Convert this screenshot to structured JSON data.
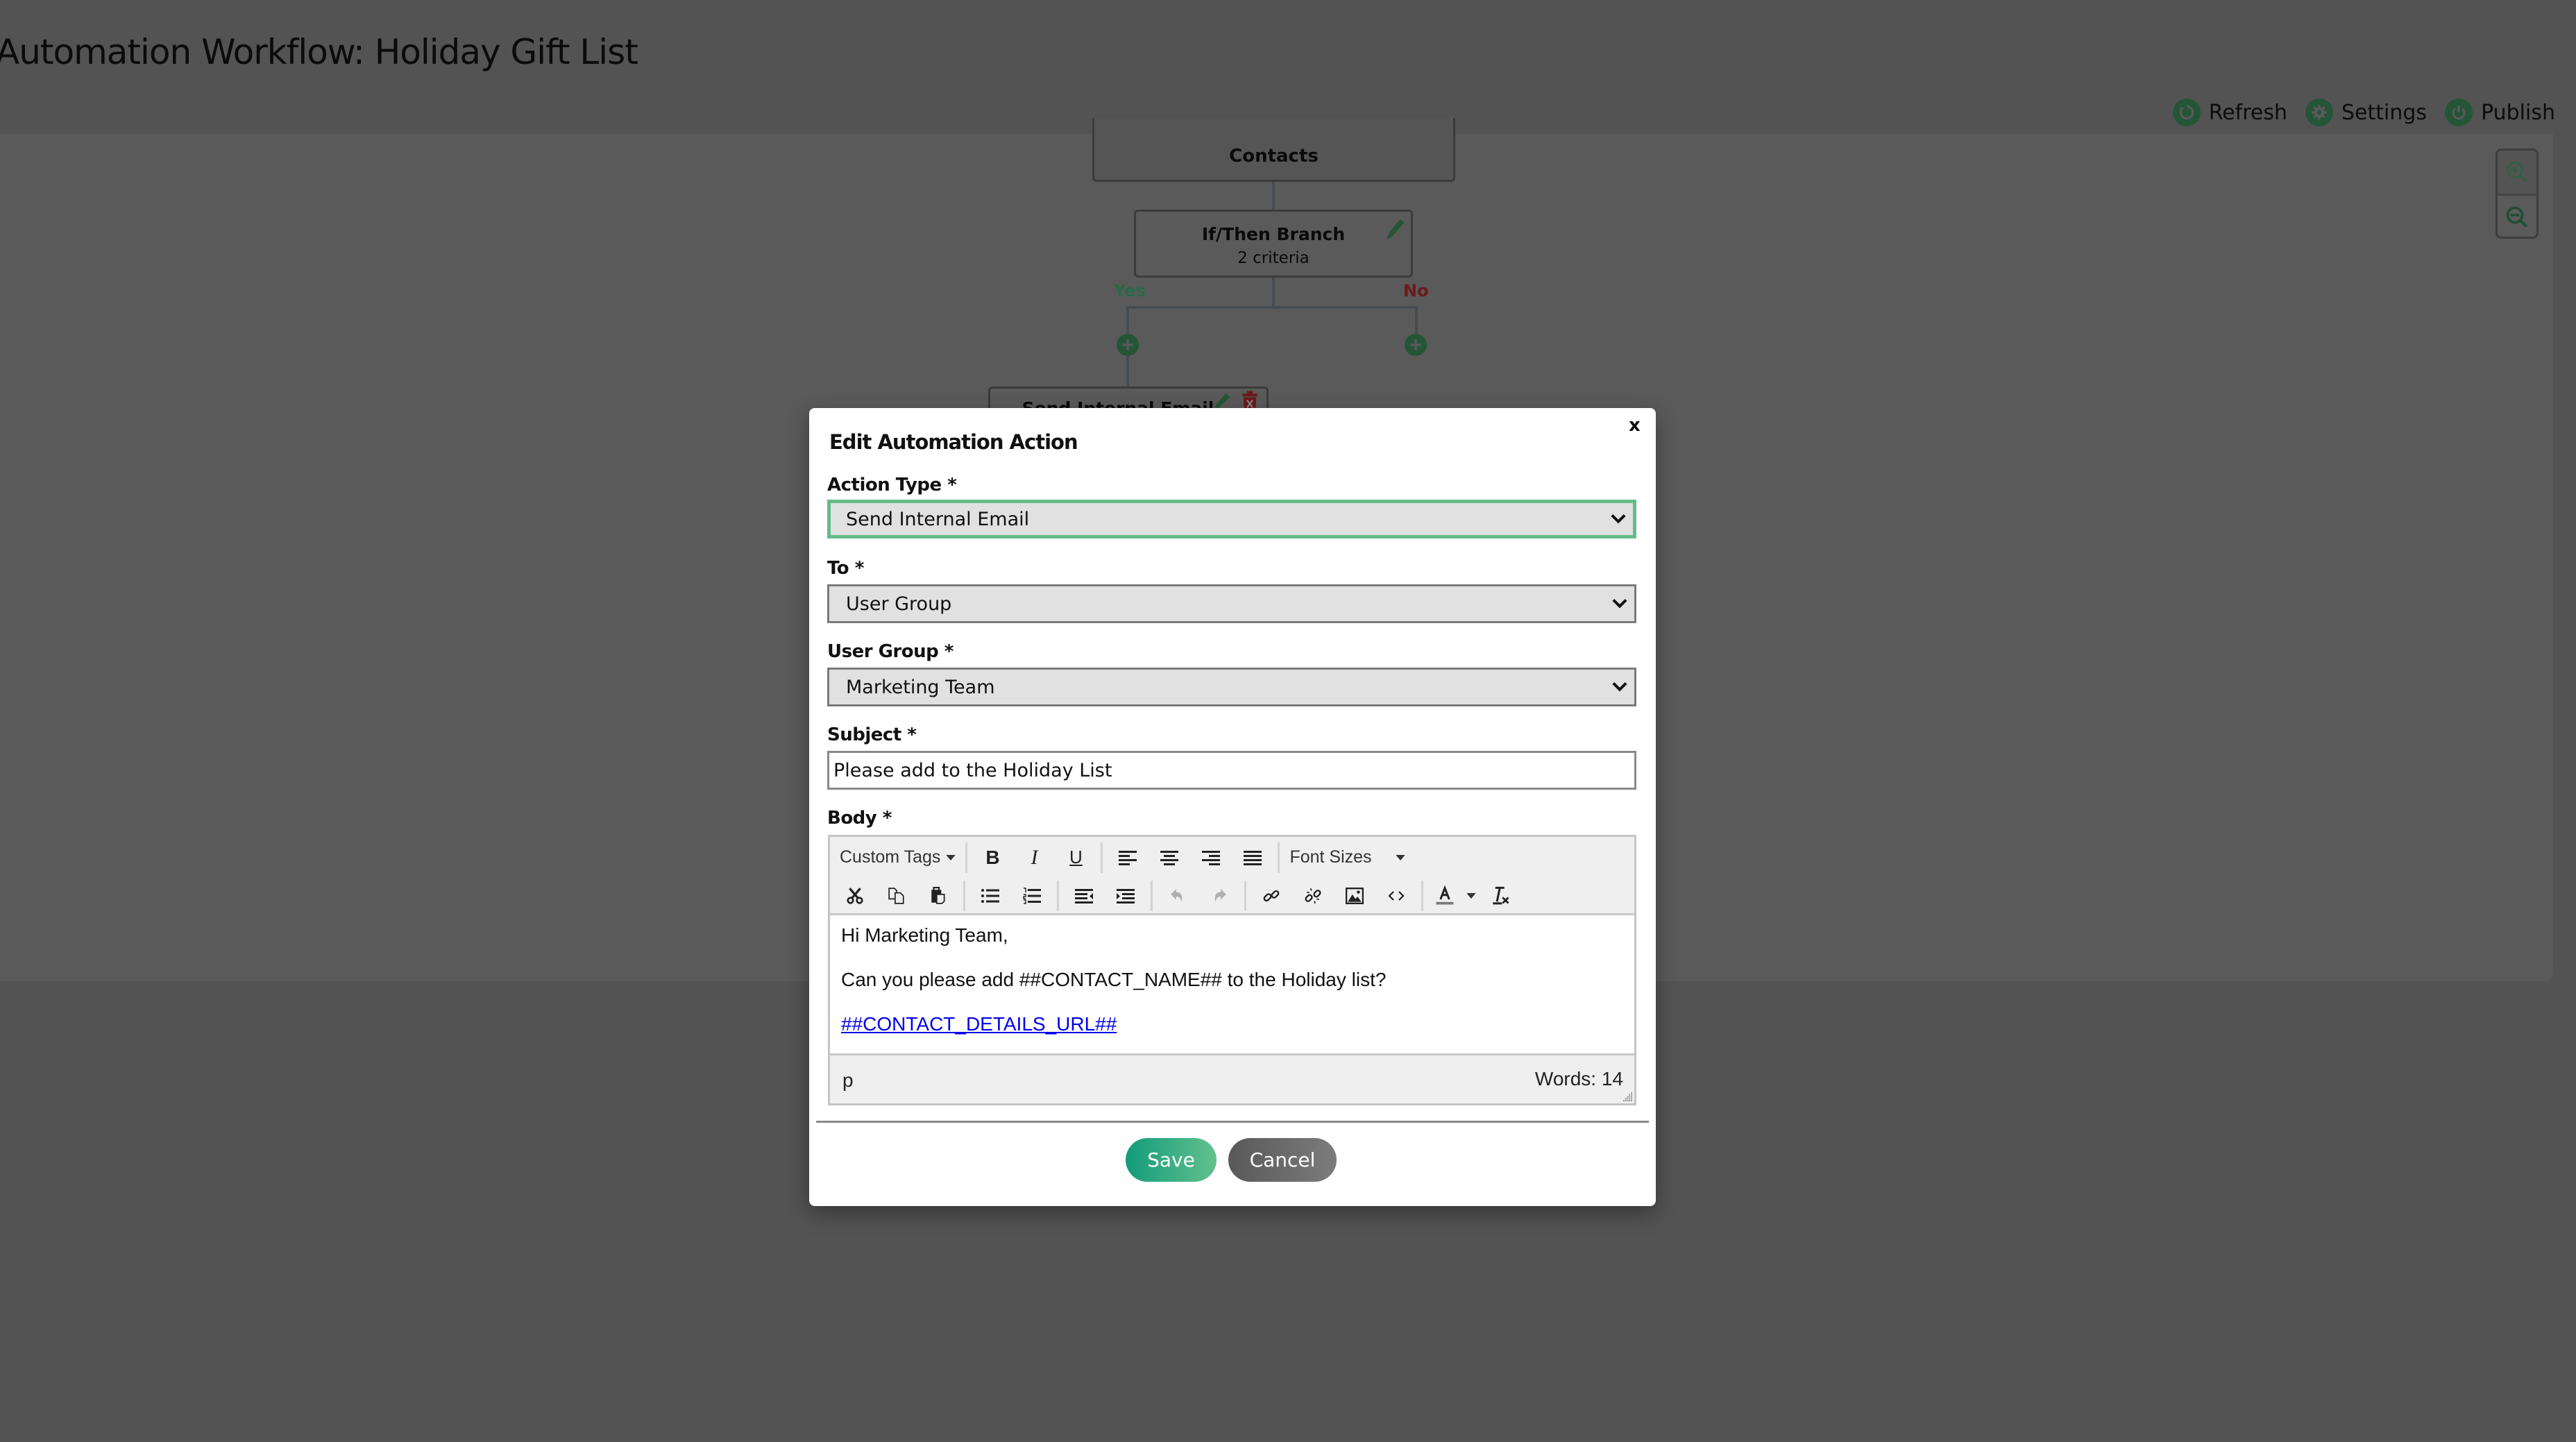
{
  "page": {
    "title": "Automation Workflow: Holiday Gift List",
    "actions": [
      {
        "label": "Refresh",
        "icon": "refresh-icon"
      },
      {
        "label": "Settings",
        "icon": "gear-icon"
      },
      {
        "label": "Publish",
        "icon": "power-icon"
      }
    ],
    "zoom_controls": [
      {
        "icon": "zoom-in-icon",
        "disabled": true
      },
      {
        "icon": "zoom-out-icon",
        "disabled": false
      }
    ]
  },
  "workflow": {
    "nodes": {
      "contacts": {
        "label": "Contacts"
      },
      "ifthen": {
        "label": "If/Then Branch",
        "detail": "2 criteria"
      },
      "email": {
        "label": "Send Internal Email"
      }
    },
    "branches": {
      "yes": "Yes",
      "no": "No"
    },
    "colors": {
      "yes": "#2a6a46",
      "no": "#6b1a1a",
      "accent": "#245536"
    }
  },
  "modal": {
    "title": "Edit Automation Action",
    "close": "x",
    "fields": {
      "action_type": {
        "label": "Action Type *",
        "value": "Send Internal Email"
      },
      "to": {
        "label": "To *",
        "value": "User Group"
      },
      "user_group": {
        "label": "User Group *",
        "value": "Marketing Team"
      },
      "subject": {
        "label": "Subject *",
        "value": "Please add to the Holiday List"
      },
      "body": {
        "label": "Body *"
      }
    },
    "editor": {
      "toolbar": {
        "custom_tags": "Custom Tags",
        "font_sizes": "Font Sizes",
        "row1": [
          "bold",
          "italic",
          "underline",
          "align-left",
          "align-center",
          "align-right",
          "align-justify"
        ],
        "row2": [
          "cut",
          "copy",
          "paste",
          "bullet-list",
          "numbered-list",
          "outdent",
          "indent",
          "undo",
          "redo",
          "link",
          "unlink",
          "image",
          "source-code",
          "text-color",
          "clear-formatting"
        ]
      },
      "content": {
        "greeting": "Hi Marketing Team,",
        "line": "Can you please add ##CONTACT_NAME## to the Holiday list?",
        "link": "##CONTACT_DETAILS_URL##"
      },
      "status": {
        "path": "p",
        "words": "Words: 14"
      }
    },
    "buttons": {
      "save": "Save",
      "cancel": "Cancel"
    },
    "colors": {
      "focus_border": "#66bb88",
      "save_start": "#149b7b",
      "save_end": "#62c18e",
      "link": "#0000ee"
    }
  }
}
